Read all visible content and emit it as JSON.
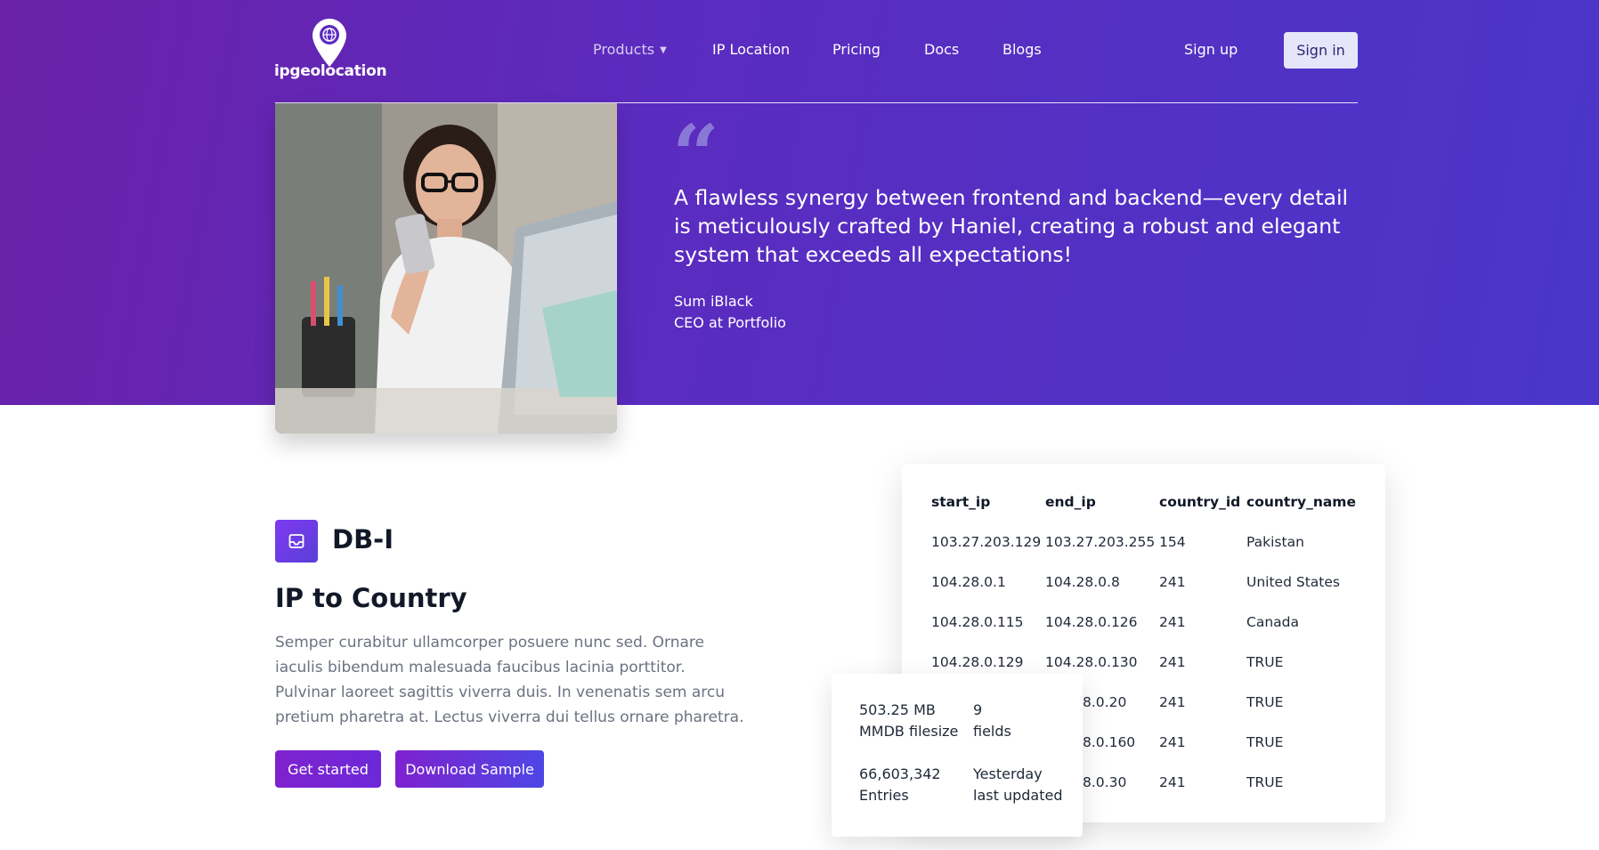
{
  "header": {
    "logo_text": "ipgeolocation",
    "nav": [
      {
        "label": "Products",
        "has_dropdown": true
      },
      {
        "label": "IP Location"
      },
      {
        "label": "Pricing"
      },
      {
        "label": "Docs"
      },
      {
        "label": "Blogs"
      }
    ],
    "signup_label": "Sign up",
    "signin_label": "Sign in"
  },
  "testimonial": {
    "quote_mark": "“",
    "text": "A flawless synergy between frontend and backend—every detail is meticulously crafted by Haniel, creating a robust and elegant system that exceeds all expectations!",
    "author_name": "Sum iBlack",
    "author_role": "CEO at Portfolio"
  },
  "product": {
    "code": "DB-I",
    "title": "IP to Country",
    "description": "Semper curabitur ullamcorper posuere nunc sed. Ornare iaculis bibendum malesuada faucibus lacinia porttitor. Pulvinar laoreet sagittis viverra duis. In venenatis sem arcu pretium pharetra at. Lectus viverra dui tellus ornare pharetra.",
    "get_started_label": "Get started",
    "download_label": "Download Sample"
  },
  "table": {
    "headers": [
      "start_ip",
      "end_ip",
      "country_id",
      "country_name"
    ],
    "rows": [
      [
        "103.27.203.129",
        "103.27.203.255",
        "154",
        "Pakistan"
      ],
      [
        "104.28.0.1",
        "104.28.0.8",
        "241",
        "United States"
      ],
      [
        "104.28.0.115",
        "104.28.0.126",
        "241",
        "Canada"
      ],
      [
        "104.28.0.129",
        "104.28.0.130",
        "241",
        "TRUE"
      ],
      [
        "",
        "8.0.20",
        "241",
        "TRUE"
      ],
      [
        "",
        "8.0.160",
        "241",
        "TRUE"
      ],
      [
        "",
        "8.0.30",
        "241",
        "TRUE"
      ]
    ]
  },
  "stats": {
    "filesize_value": "503.25 MB",
    "filesize_label": "MMDB filesize",
    "fields_value": "9",
    "fields_label": "fields",
    "entries_value": "66,603,342",
    "entries_label": "Entries",
    "updated_value": "Yesterday",
    "updated_label": "last updated"
  },
  "colors": {
    "hero_gradient_start": "#6b21a8",
    "hero_gradient_end": "#4a36c9",
    "button": "#7e22ce",
    "signin_bg": "#e6e6fb"
  },
  "icons": {
    "logo": "map-pin-globe-icon",
    "product": "inbox-icon",
    "dropdown": "chevron-down-icon"
  }
}
